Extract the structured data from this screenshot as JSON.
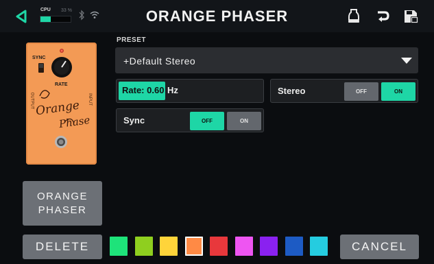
{
  "topbar": {
    "title": "ORANGE PHASER",
    "cpu_label": "CPU",
    "cpu_percent_text": "33 %",
    "cpu_load": 0.33,
    "icons": [
      "back-icon",
      "bluetooth-icon",
      "wifi-icon",
      "tuner-icon",
      "undo-icon",
      "save-icon"
    ]
  },
  "pedal": {
    "sync_label": "SYNC",
    "rate_label": "RATE",
    "output_label": "OUTPUT",
    "input_label": "INPUT",
    "script": "Orange",
    "script2": "Phase"
  },
  "preset": {
    "label": "PRESET",
    "value": "+Default Stereo"
  },
  "params": {
    "rate": {
      "value_text": "Rate: 0.60",
      "unit": "Hz"
    },
    "stereo": {
      "label": "Stereo",
      "off": "OFF",
      "on": "ON",
      "state": "on"
    },
    "sync": {
      "label": "Sync",
      "off": "OFF",
      "on": "ON",
      "state": "off"
    }
  },
  "model_button": {
    "line1": "ORANGE",
    "line2": "PHASER"
  },
  "delete_label": "DELETE",
  "cancel_label": "CANCEL",
  "swatches": [
    "#1ee37a",
    "#8fcf1f",
    "#ffd43a",
    "#ff8a45",
    "#e8383c",
    "#ee55f2",
    "#8a21f0",
    "#1d5bc4",
    "#25cce0"
  ],
  "selected_swatch_index": 3,
  "colors": {
    "accent": "#1ed6a6",
    "pedal": "#f39a55"
  }
}
